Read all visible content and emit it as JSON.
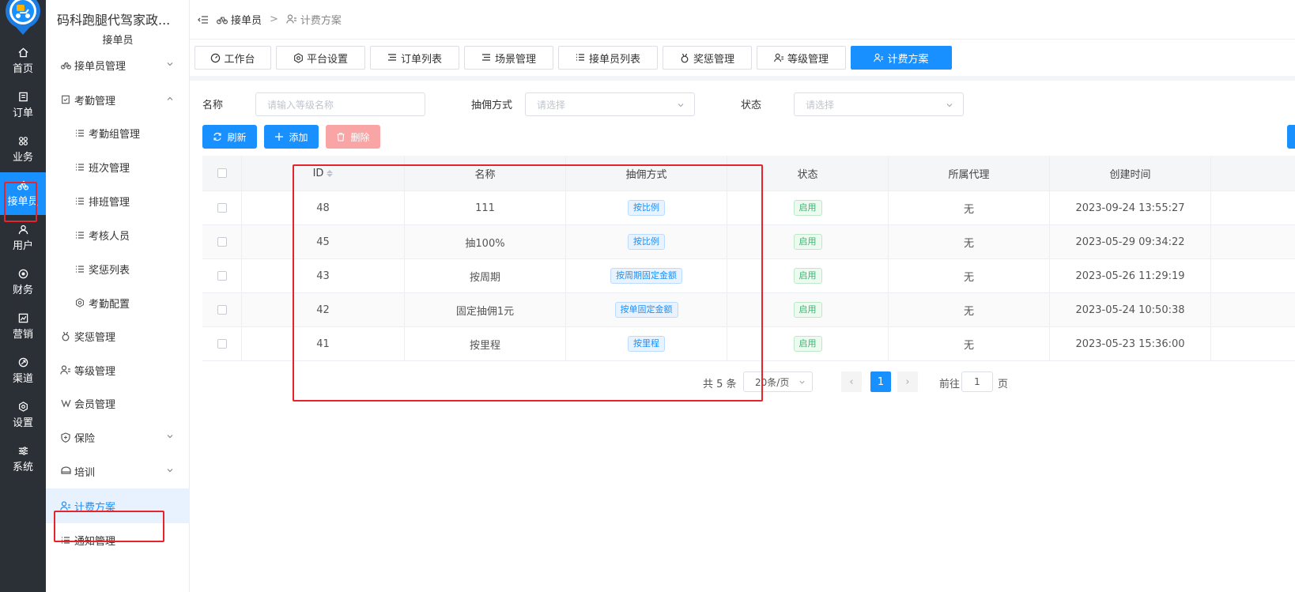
{
  "rail": {
    "items": [
      {
        "label": "首页",
        "icon": "home-icon"
      },
      {
        "label": "订单",
        "icon": "order-icon"
      },
      {
        "label": "业务",
        "icon": "business-icon"
      },
      {
        "label": "接单员",
        "icon": "bike-icon"
      },
      {
        "label": "用户",
        "icon": "user-icon"
      },
      {
        "label": "财务",
        "icon": "finance-icon"
      },
      {
        "label": "营销",
        "icon": "marketing-icon"
      },
      {
        "label": "渠道",
        "icon": "channel-icon"
      },
      {
        "label": "设置",
        "icon": "gear-icon"
      },
      {
        "label": "系统",
        "icon": "sliders-icon"
      }
    ],
    "active_index": 3,
    "active_color": "#1890ff"
  },
  "sidebar": {
    "title": "码科跑腿代驾家政...",
    "subtitle": "接单员",
    "items": [
      {
        "label": "接单员管理",
        "icon": "bike-icon",
        "level": 1,
        "chevron": "down"
      },
      {
        "label": "考勤管理",
        "icon": "attendance-icon",
        "level": 1,
        "chevron": "up"
      },
      {
        "label": "考勤组管理",
        "icon": "list-icon",
        "level": 2
      },
      {
        "label": "班次管理",
        "icon": "list-icon",
        "level": 2
      },
      {
        "label": "排班管理",
        "icon": "list-icon",
        "level": 2
      },
      {
        "label": "考核人员",
        "icon": "list-icon",
        "level": 2
      },
      {
        "label": "奖惩列表",
        "icon": "list-icon",
        "level": 2
      },
      {
        "label": "考勤配置",
        "icon": "gear-icon",
        "level": 2
      },
      {
        "label": "奖惩管理",
        "icon": "medal-icon",
        "level": 1
      },
      {
        "label": "等级管理",
        "icon": "users-icon",
        "level": 1
      },
      {
        "label": "会员管理",
        "icon": "vip-icon",
        "level": 1
      },
      {
        "label": "保险",
        "icon": "shield-icon",
        "level": 1,
        "chevron": "down"
      },
      {
        "label": "培训",
        "icon": "training-icon",
        "level": 1,
        "chevron": "down"
      },
      {
        "label": "计费方案",
        "icon": "users-icon",
        "level": 1,
        "active": true
      },
      {
        "label": "通知管理",
        "icon": "list-icon",
        "level": 1
      }
    ]
  },
  "breadcrumb": {
    "items": [
      "接单员",
      "计费方案"
    ],
    "separator": ">"
  },
  "tabs": [
    {
      "label": "工作台",
      "icon": "dashboard-icon"
    },
    {
      "label": "平台设置",
      "icon": "gear-icon"
    },
    {
      "label": "订单列表",
      "icon": "list-icon"
    },
    {
      "label": "场景管理",
      "icon": "list-icon"
    },
    {
      "label": "接单员列表",
      "icon": "list-icon"
    },
    {
      "label": "奖惩管理",
      "icon": "medal-icon"
    },
    {
      "label": "等级管理",
      "icon": "users-icon"
    },
    {
      "label": "计费方案",
      "icon": "users-icon",
      "active": true
    }
  ],
  "filters": {
    "name_label": "名称",
    "name_placeholder": "请输入等级名称",
    "commission_label": "抽佣方式",
    "commission_placeholder": "请选择",
    "status_label": "状态",
    "status_placeholder": "请选择"
  },
  "actions": {
    "refresh": "刷新",
    "add": "添加",
    "delete": "删除"
  },
  "table": {
    "columns": [
      "ID",
      "名称",
      "抽佣方式",
      "状态",
      "所属代理",
      "创建时间"
    ],
    "rows": [
      {
        "id": "48",
        "name": "111",
        "commission": "按比例",
        "status": "启用",
        "agent": "无",
        "created": "2023-09-24 13:55:27"
      },
      {
        "id": "45",
        "name": "抽100%",
        "commission": "按比例",
        "status": "启用",
        "agent": "无",
        "created": "2023-05-29 09:34:22"
      },
      {
        "id": "43",
        "name": "按周期",
        "commission": "按周期固定金额",
        "status": "启用",
        "agent": "无",
        "created": "2023-05-26 11:29:19"
      },
      {
        "id": "42",
        "name": "固定抽佣1元",
        "commission": "按单固定金额",
        "status": "启用",
        "agent": "无",
        "created": "2023-05-24 10:50:38"
      },
      {
        "id": "41",
        "name": "按里程",
        "commission": "按里程",
        "status": "启用",
        "agent": "无",
        "created": "2023-05-23 15:36:00"
      }
    ]
  },
  "pagination": {
    "total": "共 5 条",
    "page_size": "20条/页",
    "prev": "‹",
    "current_page": "1",
    "next": "›",
    "goto_label": "前往",
    "goto_value": "1",
    "page_suffix": "页"
  },
  "colors": {
    "primary": "#1890ff",
    "rail_bg": "#2b2f36",
    "danger_light": "#f9a5a5",
    "success": "#3cb371",
    "highlight_box": "#e5242b"
  }
}
